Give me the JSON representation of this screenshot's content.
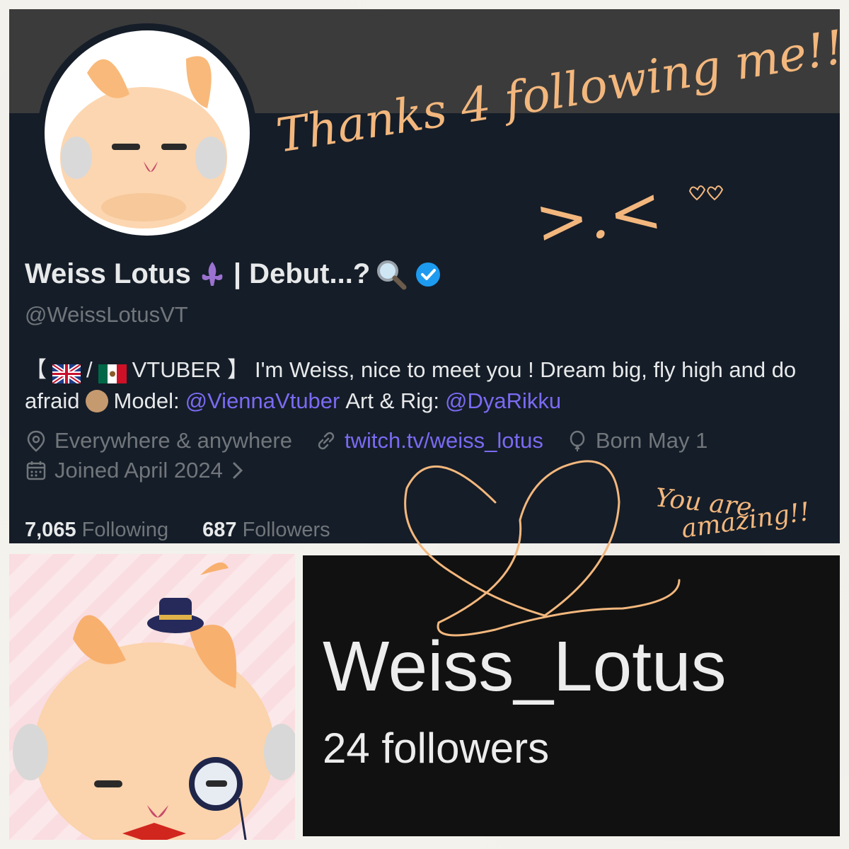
{
  "profile": {
    "display_name_prefix": "Weiss Lotus",
    "display_name_suffix": "| Debut...?",
    "handle": "@WeissLotusVT",
    "bio": {
      "open_bracket": "【",
      "slash": "/",
      "vtuber_tag": "VTUBER 】",
      "line1_text": "I'm Weiss, nice to meet you ! Dream big, fly high and do",
      "line2_text": "afraid",
      "model_label": "Model:",
      "model_mention": "@ViennaVtuber",
      "art_label": "Art & Rig:",
      "art_mention": "@DyaRikku"
    },
    "location": "Everywhere & anywhere",
    "website": "twitch.tv/weiss_lotus",
    "birthday": "Born May 1",
    "joined": "Joined April 2024",
    "following_count": "7,065",
    "following_label": "Following",
    "followers_count": "687",
    "followers_label": "Followers",
    "icons": {
      "location": "location-pin-icon",
      "link": "link-icon",
      "birthday": "balloon-icon",
      "joined": "calendar-icon",
      "verified": "verified-badge-icon"
    },
    "colors": {
      "background": "#151d28",
      "banner": "#3b3b3b",
      "link": "#7b6af2",
      "verified": "#1d9bf0"
    }
  },
  "twitch_card": {
    "username": "Weiss_Lotus",
    "followers": "24 followers"
  },
  "handwriting": {
    "thanks": "Thanks 4 following me!!",
    "face": ">.<",
    "amazing_line1": "You are",
    "amazing_line2": "amazing!!",
    "ink_color": "#f3b77d"
  }
}
